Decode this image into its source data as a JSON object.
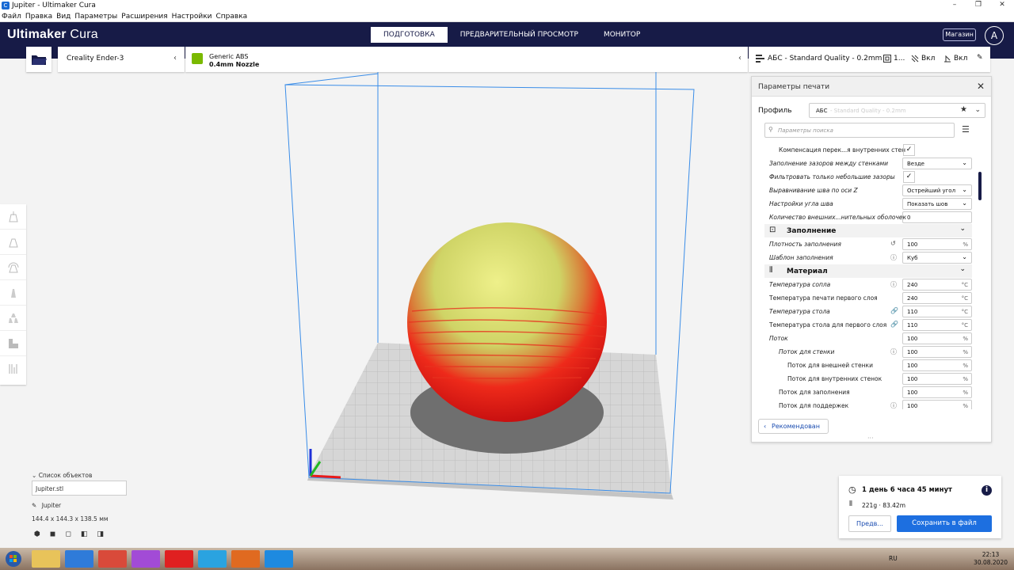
{
  "window": {
    "title": "Jupiter - Ultimaker Cura",
    "controls": [
      "–",
      "❐",
      "✕"
    ]
  },
  "menu": [
    "Файл",
    "Правка",
    "Вид",
    "Параметры",
    "Расширения",
    "Настройки",
    "Справка"
  ],
  "header": {
    "logo_bold": "Ultimaker",
    "logo_light": " Cura",
    "stages": [
      "ПОДГОТОВКА",
      "ПРЕДВАРИТЕЛЬНЫЙ ПРОСМОТР",
      "МОНИТОР"
    ],
    "active_stage": 0,
    "store_label": "Магазин",
    "account_initial": "A"
  },
  "machine": {
    "name": "Creality Ender-3"
  },
  "material": {
    "name": "Generic ABS",
    "nozzle": "0.4mm Nozzle"
  },
  "print_setup": {
    "profile": "АБС - Standard Quality - 0.2mm",
    "infill": "1...",
    "support": "Вкл",
    "adhesion": "Вкл"
  },
  "panel": {
    "title": "Параметры печати",
    "profile_label": "Профиль",
    "profile_name": "АБС",
    "profile_quality": " - Standard Quality - 0.2mm",
    "search_placeholder": "Параметры поиска",
    "rows": [
      {
        "label": "Компенсация перек...я внутренних стен",
        "type": "check",
        "value": "✓",
        "indent": 2,
        "italic": false
      },
      {
        "label": "Заполнение зазоров между стенками",
        "type": "select",
        "value": "Везде",
        "indent": 1
      },
      {
        "label": "Фильтровать только небольшие зазоры",
        "type": "check",
        "value": "✓",
        "indent": 1
      },
      {
        "label": "Выравнивание шва по оси Z",
        "type": "select",
        "value": "Острейший угол",
        "indent": 1
      },
      {
        "label": "Настройки угла шва",
        "type": "select",
        "value": "Показать шов",
        "indent": 1
      },
      {
        "label": "Количество внешних...нительных оболочек",
        "type": "num",
        "value": "0",
        "unit": "",
        "indent": 1,
        "icon": "ⓘ"
      },
      {
        "category": "Заполнение",
        "icon": "⊡"
      },
      {
        "label": "Плотность заполнения",
        "type": "num",
        "value": "100",
        "unit": "%",
        "indent": 1,
        "icon": "↺"
      },
      {
        "label": "Шаблон заполнения",
        "type": "select",
        "value": "Куб",
        "indent": 1,
        "icon": "ⓘ"
      },
      {
        "category": "Материал",
        "icon": "⦀"
      },
      {
        "label": "Температура сопла",
        "type": "num",
        "value": "240",
        "unit": "°C",
        "indent": 1,
        "icon": "ⓘ"
      },
      {
        "label": "Температура печати первого слоя",
        "type": "num",
        "value": "240",
        "unit": "°C",
        "indent": 1,
        "italic": false
      },
      {
        "label": "Температура стола",
        "type": "num",
        "value": "110",
        "unit": "°C",
        "indent": 1,
        "icon": "🔗"
      },
      {
        "label": "Температура стола для первого слоя",
        "type": "num",
        "value": "110",
        "unit": "°C",
        "indent": 1,
        "icon": "🔗",
        "italic": false
      },
      {
        "label": "Поток",
        "type": "num",
        "value": "100",
        "unit": "%",
        "indent": 1
      },
      {
        "label": "Поток для стенки",
        "type": "num",
        "value": "100",
        "unit": "%",
        "indent": 2,
        "icon": "ⓘ"
      },
      {
        "label": "Поток для внешней стенки",
        "type": "num",
        "value": "100",
        "unit": "%",
        "indent": 3,
        "italic": false
      },
      {
        "label": "Поток для внутренних стенок",
        "type": "num",
        "value": "100",
        "unit": "%",
        "indent": 3,
        "italic": false
      },
      {
        "label": "Поток для заполнения",
        "type": "num",
        "value": "100",
        "unit": "%",
        "indent": 2,
        "italic": false
      },
      {
        "label": "Поток для поддержек",
        "type": "num",
        "value": "100",
        "unit": "%",
        "indent": 2,
        "icon": "ⓘ"
      }
    ],
    "recommended_label": "Рекомендован",
    "recommended_chevron": "‹"
  },
  "objects": {
    "header": "Список объектов",
    "file": "Jupiter.stl",
    "model_name": "Jupiter",
    "dimensions": "144.4 x 144.3 x 138.5 мм"
  },
  "action": {
    "time": "1 день 6 часа 45 минут",
    "material_usage": "221g · 83.42m",
    "preview_label": "Предв...",
    "save_label": "Сохранить в файл",
    "info_glyph": "i"
  },
  "taskbar": {
    "lang": "RU",
    "time": "22:13",
    "date": "30.08.2020"
  },
  "colors": {
    "header": "#171b47",
    "accent": "#1d6fe0",
    "model_top": "#d7e06a",
    "model_overhang": "#ff2a1a"
  }
}
